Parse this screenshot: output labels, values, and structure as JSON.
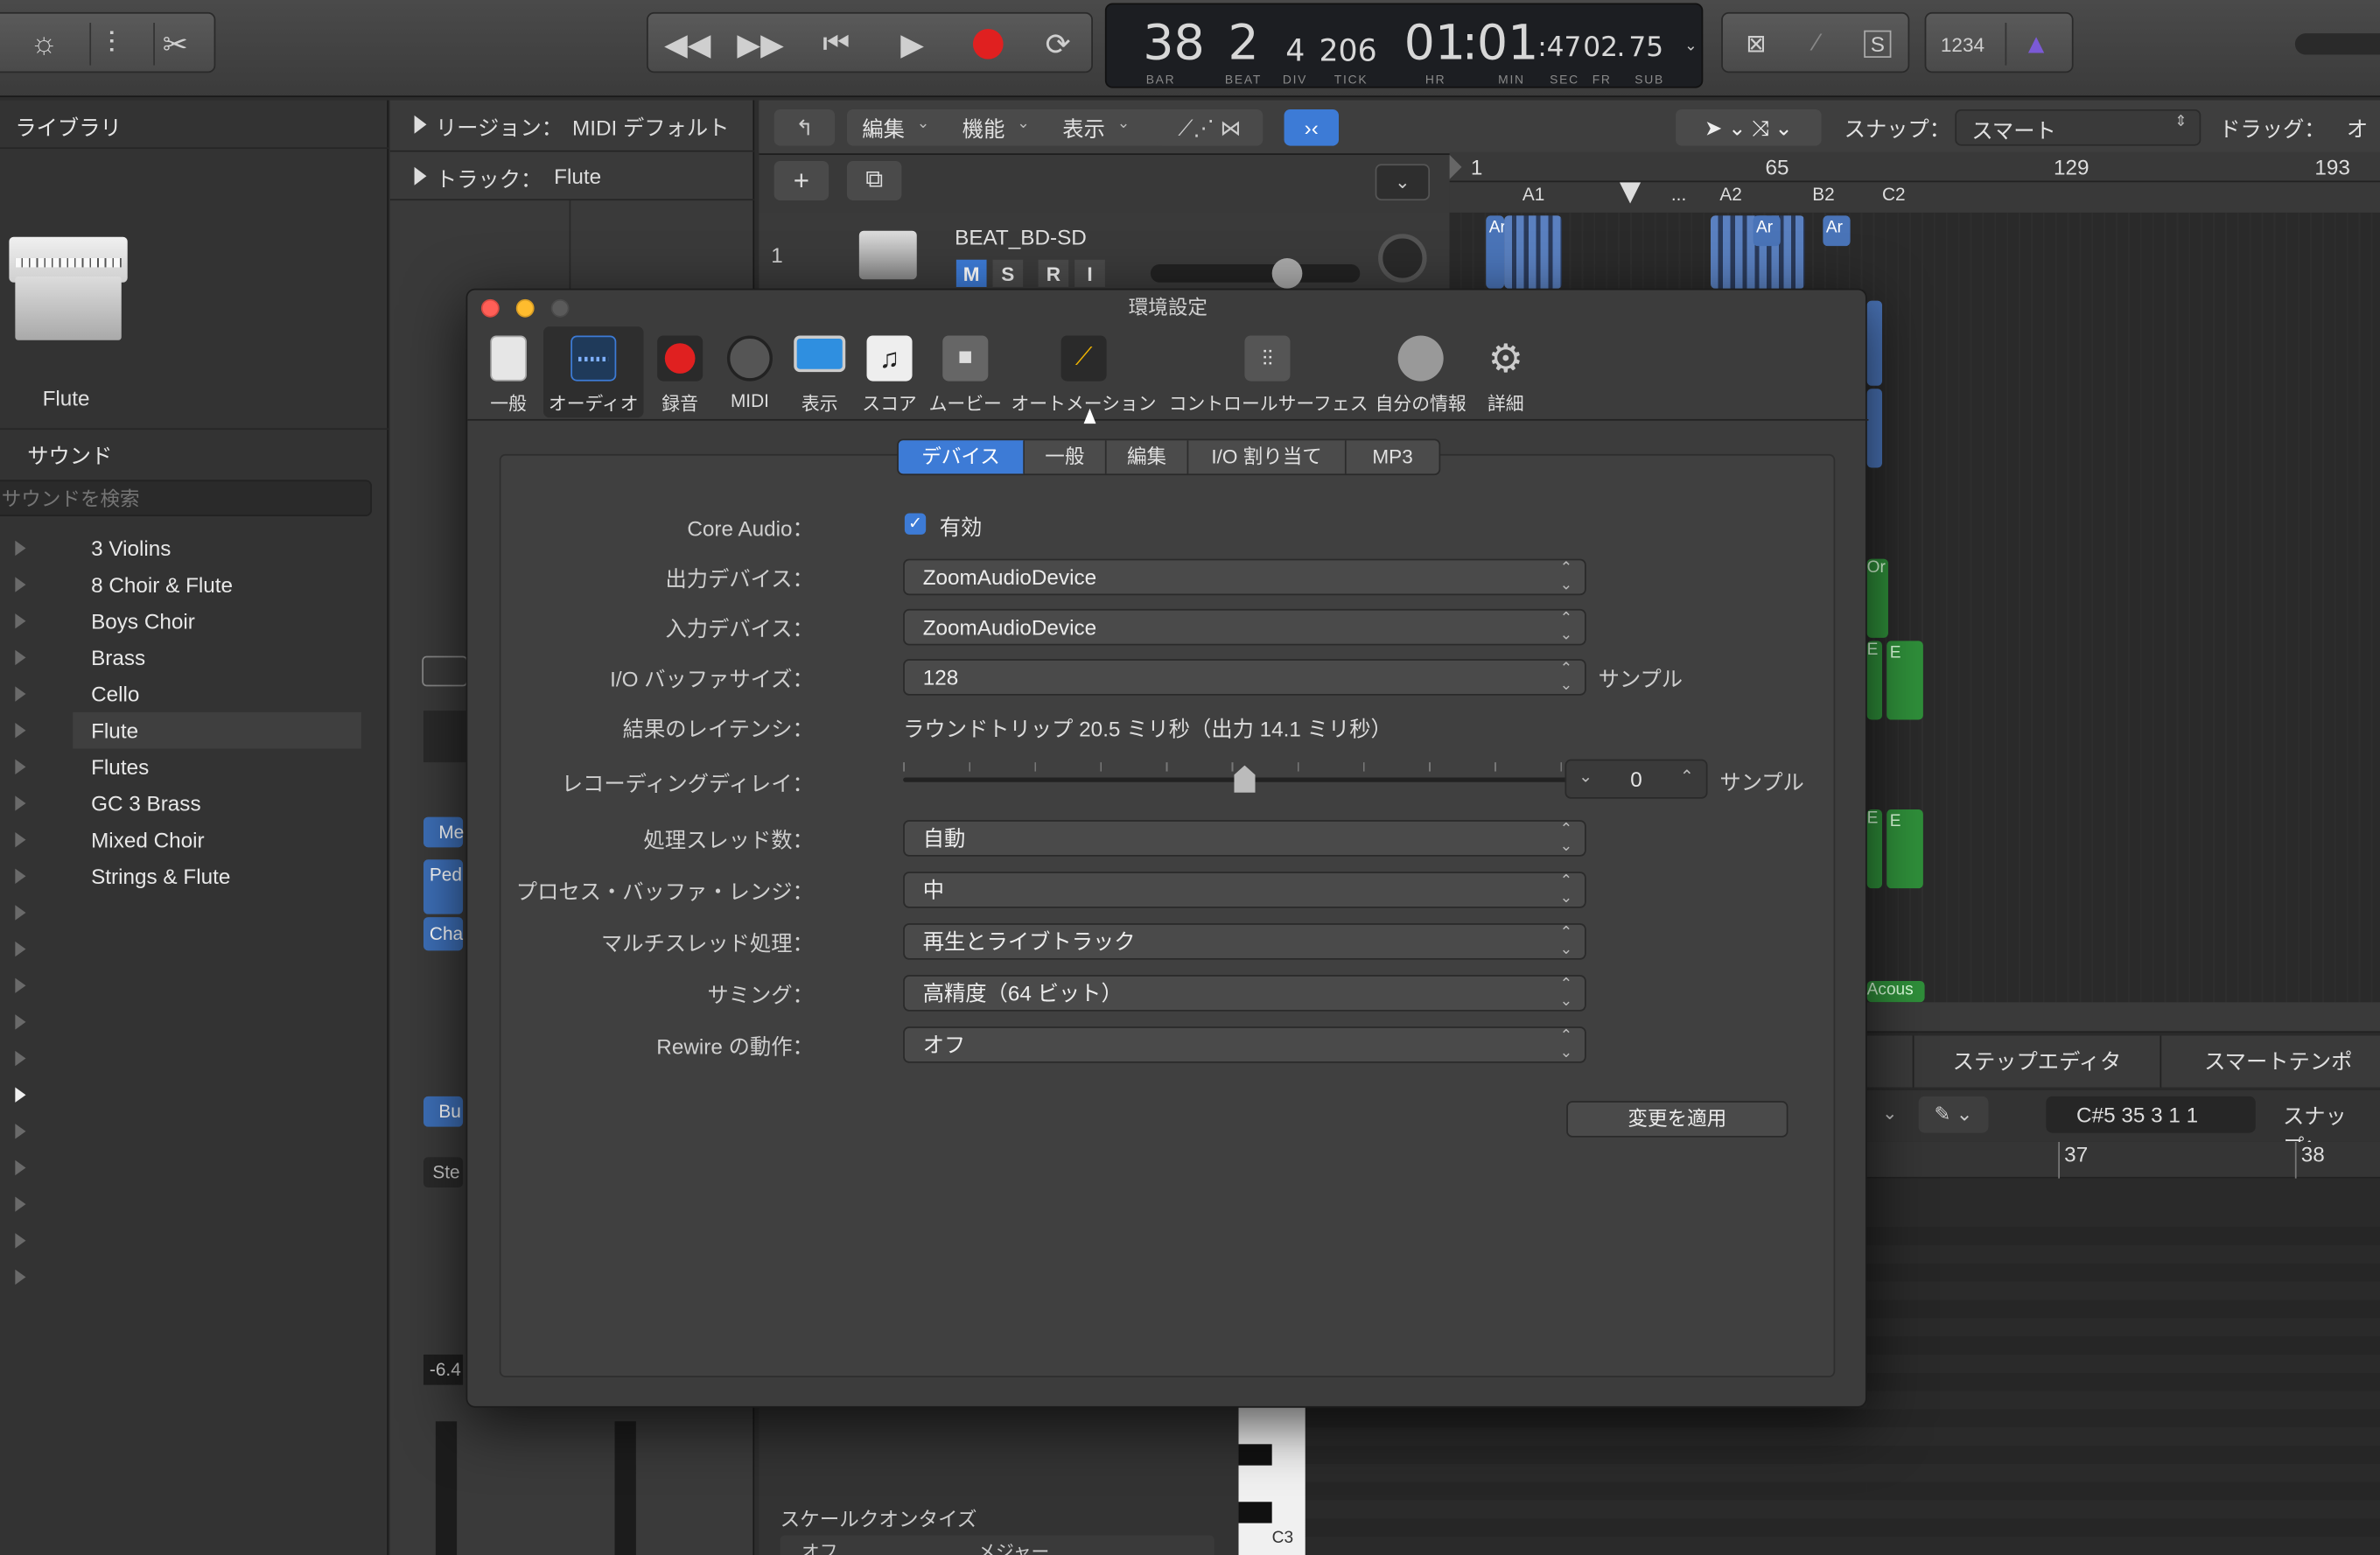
{
  "toolbar": {
    "lcd": {
      "bar": "38",
      "beat": "2",
      "div": "4",
      "tick": "206",
      "hr": "01",
      "min": "01",
      "sec": "47",
      "frame": "02",
      "sub": "75",
      "labels": {
        "bar": "BAR",
        "beat": "BEAT",
        "div": "DIV",
        "tick": "TICK",
        "hr": "HR",
        "min": "MIN",
        "sec": "SEC",
        "fr": "FR",
        "sub": "SUB"
      }
    },
    "count_in": "1234"
  },
  "library": {
    "title": "ライブラリ",
    "instrument": "Flute",
    "sound_header": "サウンド",
    "search_placeholder": "サウンドを検索",
    "items": [
      "3 Violins",
      "8 Choir & Flute",
      "Boys Choir",
      "Brass",
      "Cello",
      "Flute",
      "Flutes",
      "GC 3 Brass",
      "Mixed Choir",
      "Strings & Flute"
    ],
    "selected": "Flute"
  },
  "inspector": {
    "region_label": "リージョン：",
    "region_value": "MIDI デフォルト",
    "track_label": "トラック：",
    "track_value": "Flute",
    "side_labels": [
      "Me",
      "Ped",
      "Cha",
      "Bu",
      "Ste",
      "-6.4"
    ]
  },
  "tracks": {
    "menus": [
      "編集",
      "機能",
      "表示"
    ],
    "snap_label": "スナップ：",
    "snap_value": "スマート",
    "drag_label": "ドラッグ：",
    "drag_value": "オー",
    "ruler": [
      "1",
      "65",
      "129",
      "193"
    ],
    "markers": [
      "A1",
      "...",
      "A2",
      "B2",
      "C2"
    ],
    "track_number": "1",
    "track_name": "BEAT_BD-SD",
    "track_buttons": [
      "M",
      "S",
      "R",
      "I"
    ],
    "clip_labels": [
      "Ar",
      "Ar",
      "Ar",
      "Or",
      "E",
      "E",
      "E",
      "E",
      "Acous"
    ],
    "step_editor": "ステップエディタ",
    "smart_tempo": "スマートテンポ",
    "note_pos": "C#5  35 3 1 1",
    "snap_lower": "スナップ：",
    "lower_ruler": [
      "37",
      "38"
    ],
    "scale_quantize": "スケールクオンタイズ",
    "scale_off": "オフ",
    "scale_major": "メジャー",
    "key_label": "C3"
  },
  "dialog": {
    "title": "環境設定",
    "prefs": [
      "一般",
      "オーディオ",
      "録音",
      "MIDI",
      "表示",
      "スコア",
      "ムービー",
      "オートメーション",
      "コントロールサーフェス",
      "自分の情報",
      "詳細"
    ],
    "selected_pref": "オーディオ",
    "tabs": [
      "デバイス",
      "一般",
      "編集",
      "I/O 割り当て",
      "MP3"
    ],
    "selected_tab": "デバイス",
    "core_audio_label": "Core Audio：",
    "core_audio_checkbox": "有効",
    "output_label": "出力デバイス：",
    "output_value": "ZoomAudioDevice",
    "input_label": "入力デバイス：",
    "input_value": "ZoomAudioDevice",
    "buffer_label": "I/O バッファサイズ：",
    "buffer_value": "128",
    "buffer_unit": "サンプル",
    "latency_label": "結果のレイテンシ：",
    "latency_value": "ラウンドトリップ 20.5 ミリ秒（出力 14.1 ミリ秒）",
    "rec_delay_label": "レコーディングディレイ：",
    "rec_delay_value": "0",
    "rec_delay_unit": "サンプル",
    "rec_delay_slider_fraction": 0.5,
    "threads_label": "処理スレッド数：",
    "threads_value": "自動",
    "process_buffer_label": "プロセス・バッファ・レンジ：",
    "process_buffer_value": "中",
    "multithread_label": "マルチスレッド処理：",
    "multithread_value": "再生とライブトラック",
    "summing_label": "サミング：",
    "summing_value": "高精度（64 ビット）",
    "rewire_label": "Rewire の動作：",
    "rewire_value": "オフ",
    "apply_button": "変更を適用"
  },
  "colors": {
    "accent": "#3d7bd6",
    "record": "#e02020",
    "green_clip": "#2f8f3a",
    "blue_clip": "#4a74b8"
  }
}
